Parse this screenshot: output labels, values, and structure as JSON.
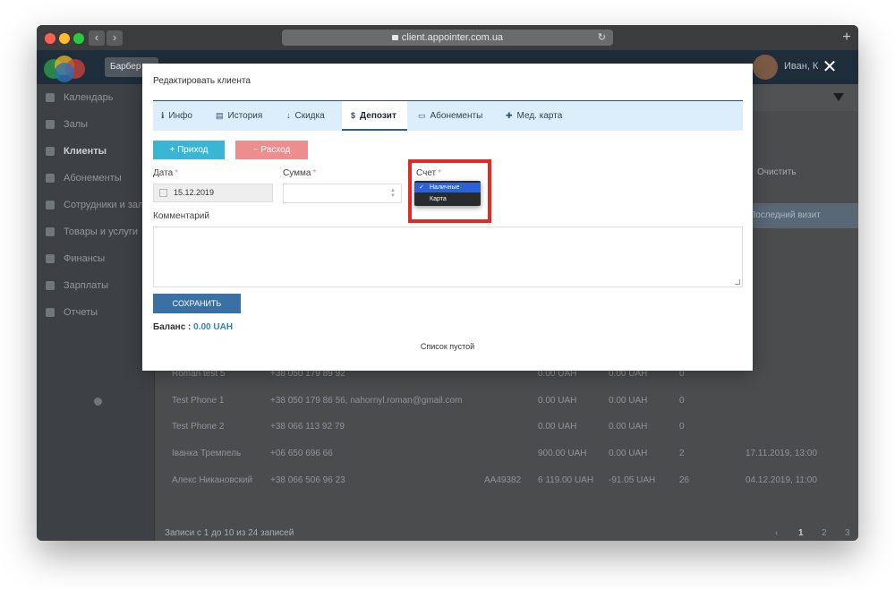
{
  "browser": {
    "url": "client.appointer.com.ua",
    "back_glyph": "‹",
    "forward_glyph": "›",
    "reload_glyph": "↻",
    "new_tab_glyph": "+"
  },
  "app": {
    "place_tab": "Барбер",
    "user_name": "Иван, К"
  },
  "sidebar": {
    "items": [
      {
        "label": "Календарь"
      },
      {
        "label": "Залы"
      },
      {
        "label": "Клиенты",
        "active": true
      },
      {
        "label": "Абонементы"
      },
      {
        "label": "Сотрудники и залы"
      },
      {
        "label": "Товары и услуги"
      },
      {
        "label": "Финансы"
      },
      {
        "label": "Зарплаты"
      },
      {
        "label": "Отчеты"
      }
    ]
  },
  "background_table": {
    "clear_label": "Очистить",
    "last_visit_header": "Последний визит",
    "rows": [
      {
        "name": "Roman test 5",
        "phone": "+38 050 179 89 92",
        "card": "",
        "balance": "0.00 UAH",
        "debt": "0.00 UAH",
        "visits": "0",
        "last_visit": ""
      },
      {
        "name": "Test Phone 1",
        "phone": "+38 050 179 86 56, nahornyl.roman@gmail.com",
        "card": "",
        "balance": "0.00 UAH",
        "debt": "0.00 UAH",
        "visits": "0",
        "last_visit": ""
      },
      {
        "name": "Test Phone 2",
        "phone": "+38 066 113 92 79",
        "card": "",
        "balance": "0.00 UAH",
        "debt": "0.00 UAH",
        "visits": "0",
        "last_visit": ""
      },
      {
        "name": "Іванка Тремпель",
        "phone": "+06 650 696 66",
        "card": "",
        "balance": "900.00 UAH",
        "debt": "0.00 UAH",
        "visits": "2",
        "last_visit": "17.11.2019, 13:00"
      },
      {
        "name": "Алекс Никановский",
        "phone": "+38 066 506 96 23",
        "card": "AA49382",
        "balance": "6 119.00 UAH",
        "debt": "-91.05 UAH",
        "visits": "26",
        "last_visit": "04.12.2019, 11:00"
      }
    ],
    "footer": "Записи с 1 до 10 из 24 записей",
    "pager": {
      "prev": "‹",
      "pages": [
        "1",
        "2",
        "3"
      ],
      "next": "›"
    }
  },
  "modal": {
    "title": "Редактировать клиента",
    "close_glyph": "✕",
    "tabs": [
      {
        "label": "Инфо",
        "icon": "info-icon",
        "glyph": "ℹ"
      },
      {
        "label": "История",
        "icon": "history-icon",
        "glyph": "▤"
      },
      {
        "label": "Скидка",
        "icon": "arrow-down-icon",
        "glyph": "↓"
      },
      {
        "label": "Депозит",
        "icon": "dollar-icon",
        "glyph": "$",
        "active": true
      },
      {
        "label": "Абонементы",
        "icon": "card-icon",
        "glyph": "▭"
      },
      {
        "label": "Мед. карта",
        "icon": "plus-square-icon",
        "glyph": "✚"
      }
    ],
    "income_label": "Приход",
    "income_glyph": "+",
    "expense_label": "Расход",
    "expense_glyph": "−",
    "date_label": "Дата",
    "date_value": "15.12.2019",
    "sum_label": "Сумма",
    "sum_value": "",
    "account_label": "Счет",
    "required_mark": "*",
    "account_options": [
      "Наличные",
      "Карта"
    ],
    "account_selected": "Наличные",
    "check_glyph": "✓",
    "comment_label": "Комментарий",
    "comment_value": "",
    "save_label": "СОХРАНИТЬ",
    "balance_label": "Баланс :",
    "balance_value": "0.00 UAH",
    "empty_text": "Список пустой"
  },
  "colors": {
    "accent": "#3a71a5",
    "income": "#3ab6d4",
    "expense": "#ee8d8d",
    "highlight": "#e52a24",
    "tab_bar": "#dceefb"
  }
}
